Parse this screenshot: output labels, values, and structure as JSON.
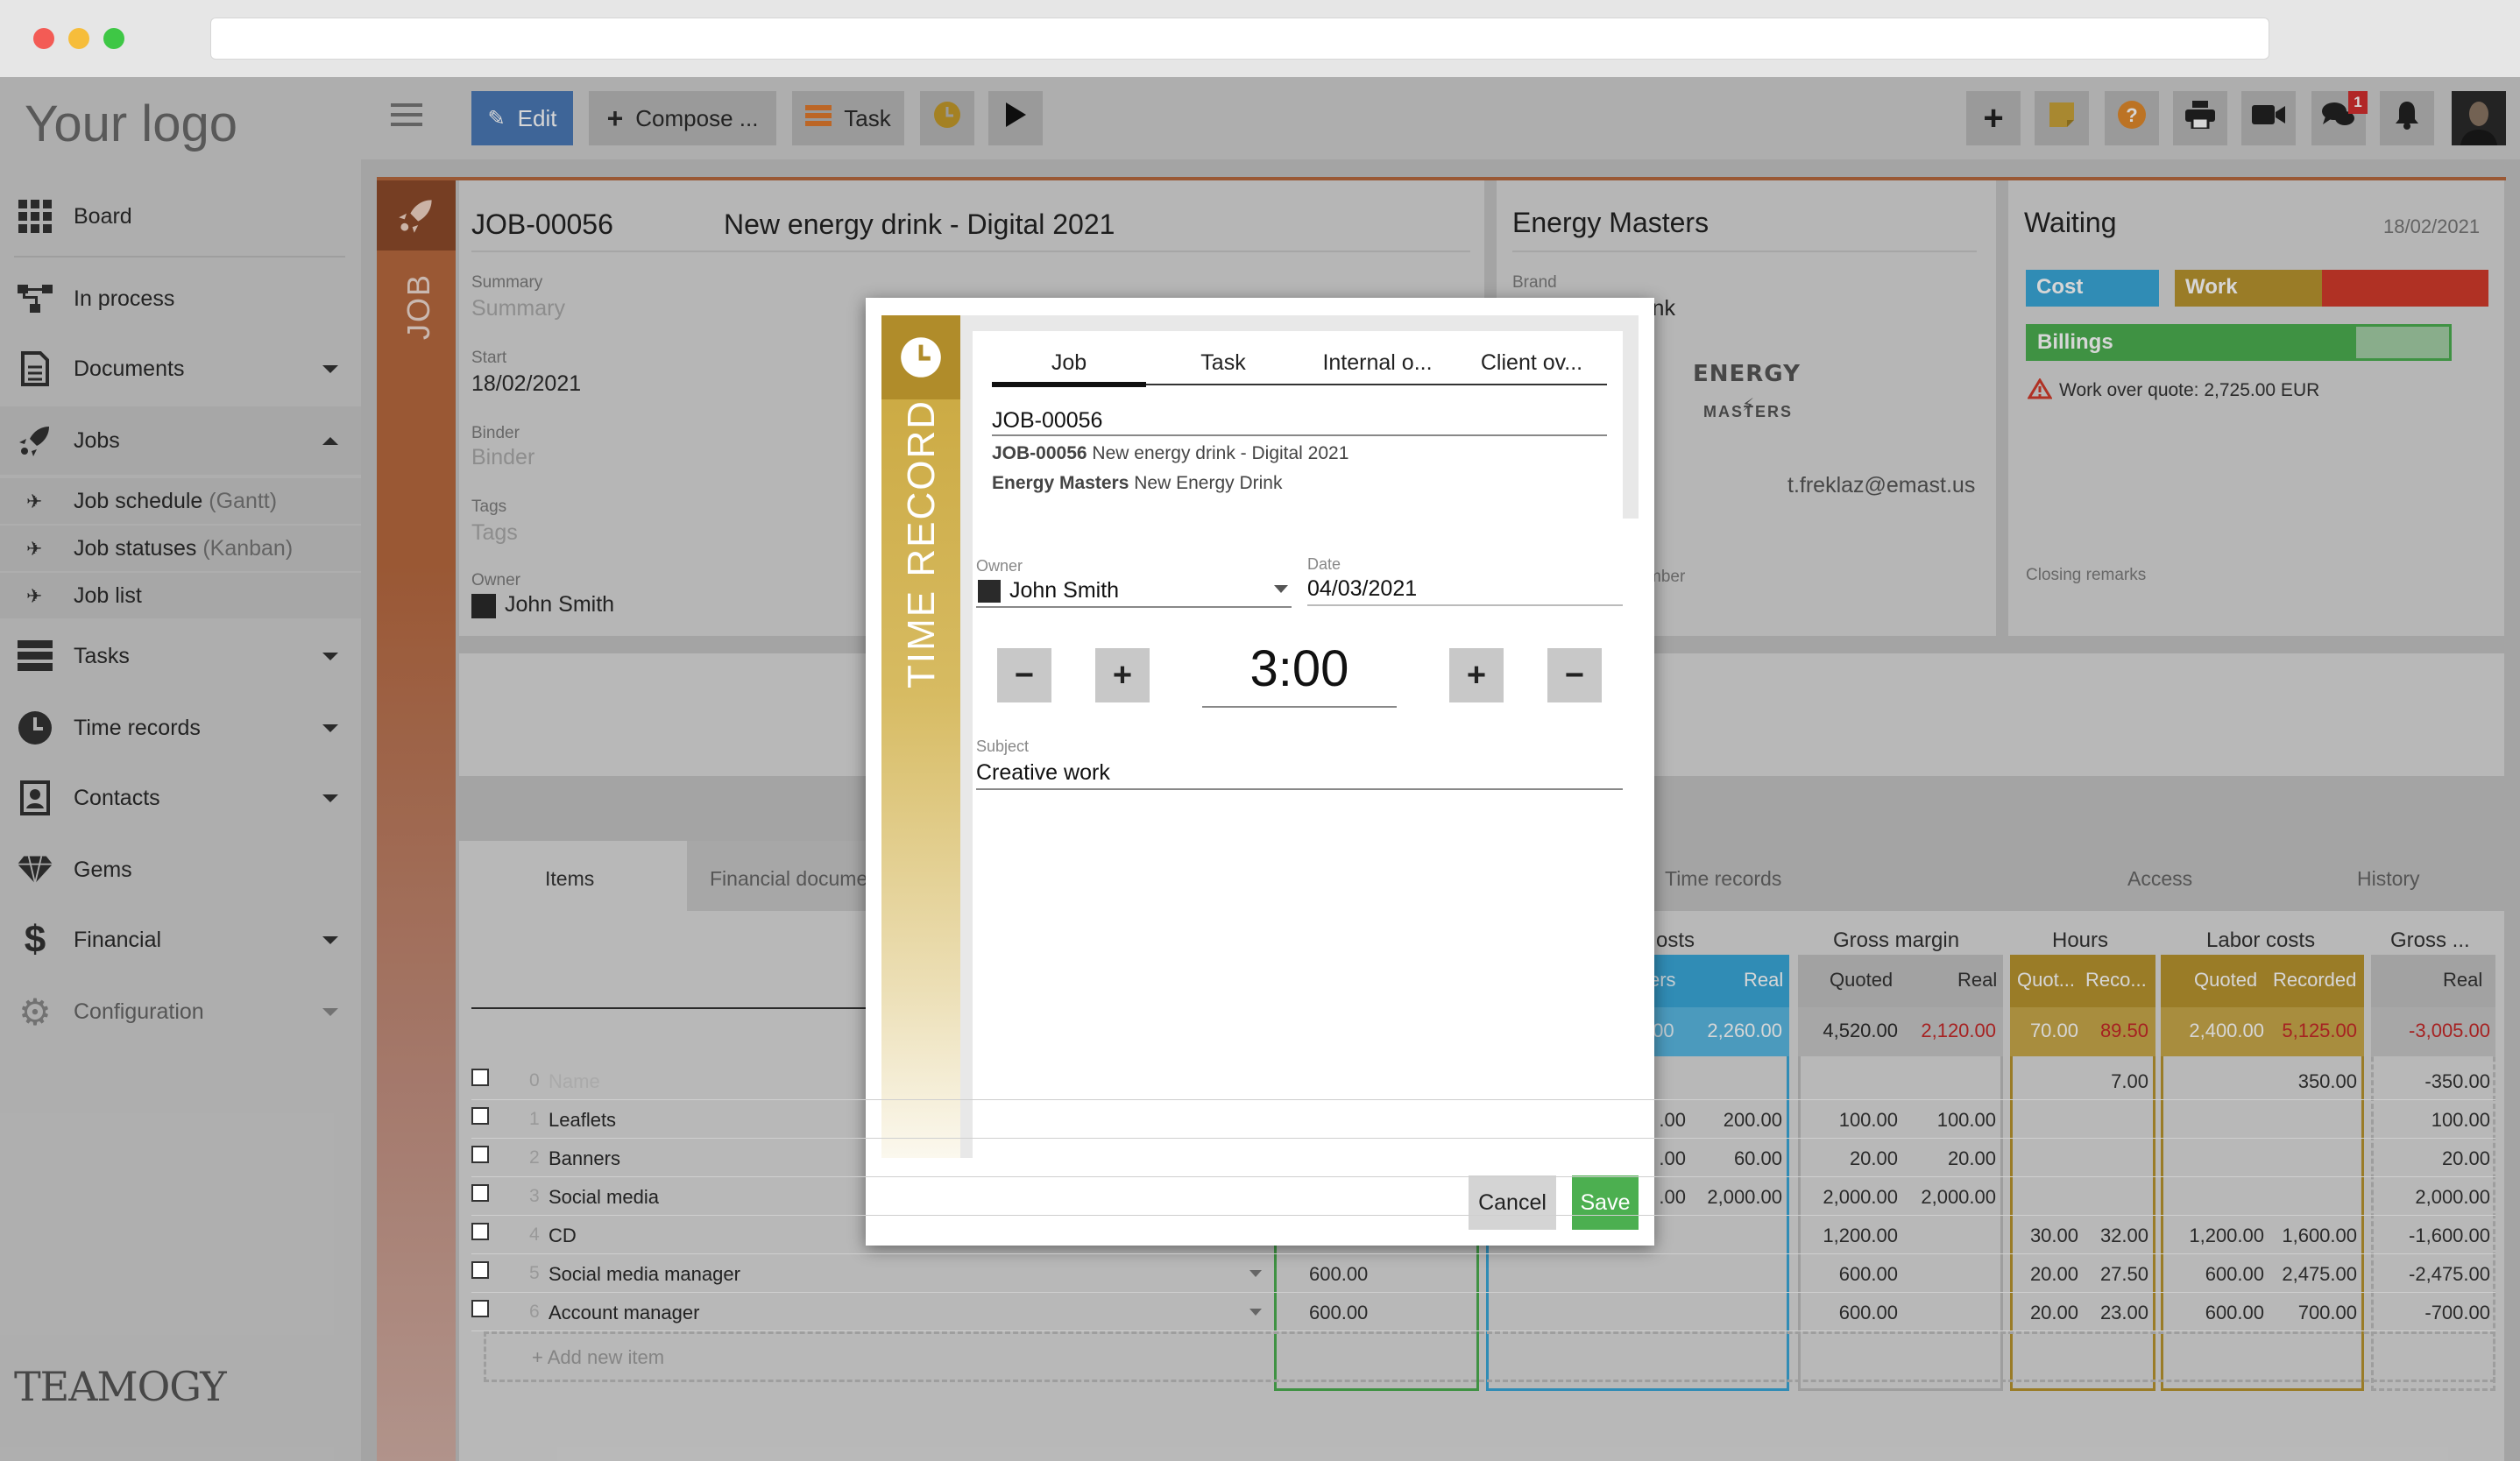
{
  "browser": {
    "url": ""
  },
  "logo": "Your logo",
  "brand_mark": "TEAMOGY",
  "sidebar": {
    "board": "Board",
    "in_process": "In process",
    "documents": "Documents",
    "jobs": "Jobs",
    "job_schedule": "Job schedule",
    "job_schedule_sub": "(Gantt)",
    "job_statuses": "Job statuses",
    "job_statuses_sub": "(Kanban)",
    "job_list": "Job list",
    "tasks": "Tasks",
    "time_records": "Time records",
    "contacts": "Contacts",
    "gems": "Gems",
    "financial": "Financial",
    "configuration": "Configuration"
  },
  "toolbar": {
    "edit": "Edit",
    "compose": "Compose ...",
    "task": "Task",
    "chat_badge": "1"
  },
  "job": {
    "side_label": "JOB",
    "number": "JOB-00056",
    "title": "New energy drink - Digital 2021",
    "summary_label": "Summary",
    "summary_placeholder": "Summary",
    "start_label": "Start",
    "start_value": "18/02/2021",
    "binder_label": "Binder",
    "binder_placeholder": "Binder",
    "tags_label": "Tags",
    "tags_placeholder": "Tags",
    "owner_label": "Owner",
    "owner_value": "John Smith"
  },
  "client": {
    "name": "Energy Masters",
    "brand_label": "Brand",
    "brand_partial": "ink",
    "logo_top": "ENERGY",
    "logo_bottom": "MASTERS",
    "email": "t.freklaz@emast.us",
    "number_partial": "mber"
  },
  "status": {
    "title": "Waiting",
    "date": "18/02/2021",
    "cost": "Cost",
    "work": "Work",
    "billings": "Billings",
    "billings_fill": 0.78,
    "warning": "Work over quote: 2,725.00 EUR",
    "closing_remarks": "Closing remarks"
  },
  "tabs": {
    "items": "Items",
    "financial": "Financial docume",
    "time_records": "Time records",
    "access": "Access",
    "history": "History"
  },
  "table": {
    "groups": {
      "costs": "osts",
      "gross_margin": "Gross margin",
      "hours": "Hours",
      "labor_costs": "Labor costs",
      "gross": "Gross ..."
    },
    "subheaders": {
      "costs_a": "ers",
      "costs_b": "Real",
      "gm_quoted": "Quoted",
      "gm_real": "Real",
      "hours_quoted": "Quot...",
      "hours_recorded": "Reco...",
      "lc_quoted": "Quoted",
      "lc_recorded": "Recorded",
      "gross_real": "Real"
    },
    "totals": {
      "costs_a": ".00",
      "costs_b": "2,260.00",
      "gm_quoted": "4,520.00",
      "gm_real": "2,120.00",
      "hours_quoted": "70.00",
      "hours_recorded": "89.50",
      "lc_quoted": "2,400.00",
      "lc_recorded": "5,125.00",
      "gross_real": "-3,005.00"
    },
    "rows": [
      {
        "n": "0",
        "name": "Name",
        "placeholder": true,
        "quoted": "",
        "ca": "",
        "cb": "",
        "gq": "",
        "gr": "",
        "hq": "",
        "hr": "7.00",
        "lq": "",
        "lr": "350.00",
        "g": "-350.00"
      },
      {
        "n": "1",
        "name": "Leaflets",
        "quoted": "",
        "ca": ".00",
        "cb": "200.00",
        "gq": "100.00",
        "gr": "100.00",
        "hq": "",
        "hr": "",
        "lq": "",
        "lr": "",
        "g": "100.00"
      },
      {
        "n": "2",
        "name": "Banners",
        "quoted": "",
        "ca": ".00",
        "cb": "60.00",
        "gq": "20.00",
        "gr": "20.00",
        "hq": "",
        "hr": "",
        "lq": "",
        "lr": "",
        "g": "20.00"
      },
      {
        "n": "3",
        "name": "Social media",
        "quoted": "",
        "ca": ".00",
        "cb": "2,000.00",
        "gq": "2,000.00",
        "gr": "2,000.00",
        "hq": "",
        "hr": "",
        "lq": "",
        "lr": "",
        "g": "2,000.00"
      },
      {
        "n": "4",
        "name": "CD",
        "quoted": "",
        "ca": "",
        "cb": "",
        "gq": "1,200.00",
        "gr": "",
        "hq": "30.00",
        "hr": "32.00",
        "lq": "1,200.00",
        "lr": "1,600.00",
        "g": "-1,600.00"
      },
      {
        "n": "5",
        "name": "Social media manager",
        "quoted": "600.00",
        "ca": "",
        "cb": "",
        "gq": "600.00",
        "gr": "",
        "hq": "20.00",
        "hr": "27.50",
        "lq": "600.00",
        "lr": "2,475.00",
        "g": "-2,475.00"
      },
      {
        "n": "6",
        "name": "Account manager",
        "quoted": "600.00",
        "ca": "",
        "cb": "",
        "gq": "600.00",
        "gr": "",
        "hq": "20.00",
        "hr": "23.00",
        "lq": "600.00",
        "lr": "700.00",
        "g": "-700.00"
      }
    ],
    "add_item": "+ Add new item"
  },
  "modal": {
    "side_label": "TIME RECORD",
    "tabs": [
      "Job",
      "Task",
      "Internal o...",
      "Client ov..."
    ],
    "job_number": "JOB-00056",
    "desc_line1_bold": "JOB-00056",
    "desc_line1": "New energy drink - Digital 2021",
    "desc_line2_bold": "Energy Masters",
    "desc_line2": "New Energy Drink",
    "owner_label": "Owner",
    "owner_value": "John Smith",
    "date_label": "Date",
    "date_value": "04/03/2021",
    "time_value": "3:00",
    "subject_label": "Subject",
    "subject_value": "Creative work",
    "cancel": "Cancel",
    "save": "Save"
  },
  "colors": {
    "accent_blue": "#4a79b5",
    "job_bar": "#b8693f",
    "modal_bar": "#c9a63c",
    "cost": "#3aa7d8",
    "work": "#b8942f",
    "over": "#d23b2b",
    "billings": "#4caf50",
    "save": "#4caf50"
  }
}
